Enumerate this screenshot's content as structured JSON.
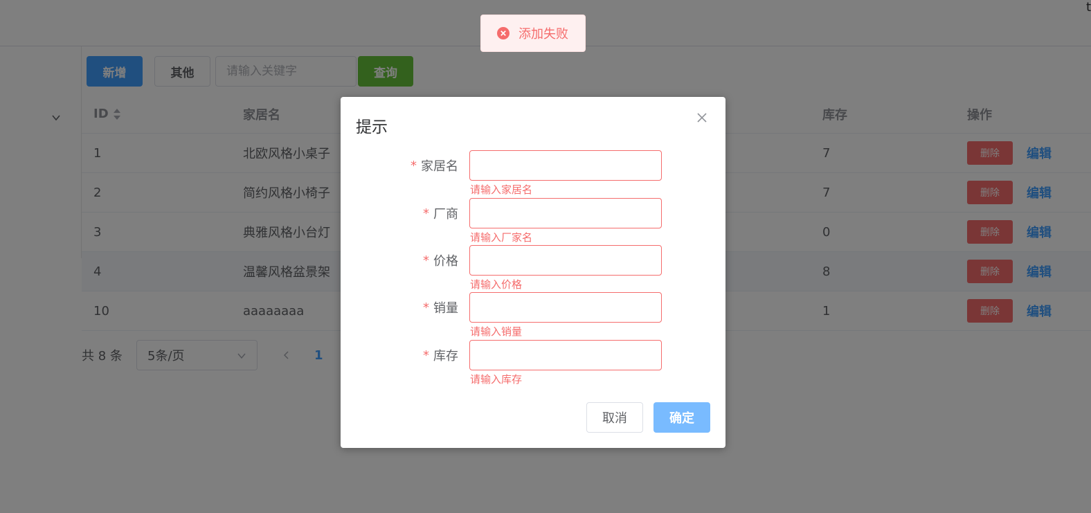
{
  "header": {
    "corner_text": "t"
  },
  "toolbar": {
    "add_label": "新增",
    "other_label": "其他",
    "search_placeholder": "请输入关键字",
    "query_label": "查询"
  },
  "table": {
    "headers": {
      "id": "ID",
      "name": "家居名",
      "stock": "库存",
      "ops": "操作"
    },
    "rows": [
      {
        "id": "1",
        "name": "北欧风格小桌子",
        "stock": "7"
      },
      {
        "id": "2",
        "name": "简约风格小椅子",
        "stock": "7"
      },
      {
        "id": "3",
        "name": "典雅风格小台灯",
        "stock": "0"
      },
      {
        "id": "4",
        "name": "温馨风格盆景架",
        "stock": "8"
      },
      {
        "id": "10",
        "name": "aaaaaaaa",
        "stock": "1"
      }
    ],
    "delete_label": "删除",
    "edit_label": "编辑"
  },
  "pager": {
    "total": "共 8 条",
    "page_size": "5条/页",
    "current_page": "1"
  },
  "dialog": {
    "title": "提示",
    "required_mark": "*",
    "fields": [
      {
        "label": "家居名",
        "error": "请输入家居名"
      },
      {
        "label": "厂商",
        "error": "请输入厂家名"
      },
      {
        "label": "价格",
        "error": "请输入价格"
      },
      {
        "label": "销量",
        "error": "请输入销量"
      },
      {
        "label": "库存",
        "error": "请输入库存"
      }
    ],
    "cancel_label": "取消",
    "confirm_label": "确定"
  },
  "toast": {
    "message": "添加失败"
  },
  "colors": {
    "primary": "#409eff",
    "success": "#67c23a",
    "danger": "#f56c6c",
    "confirm_disabled": "#79bbff"
  }
}
